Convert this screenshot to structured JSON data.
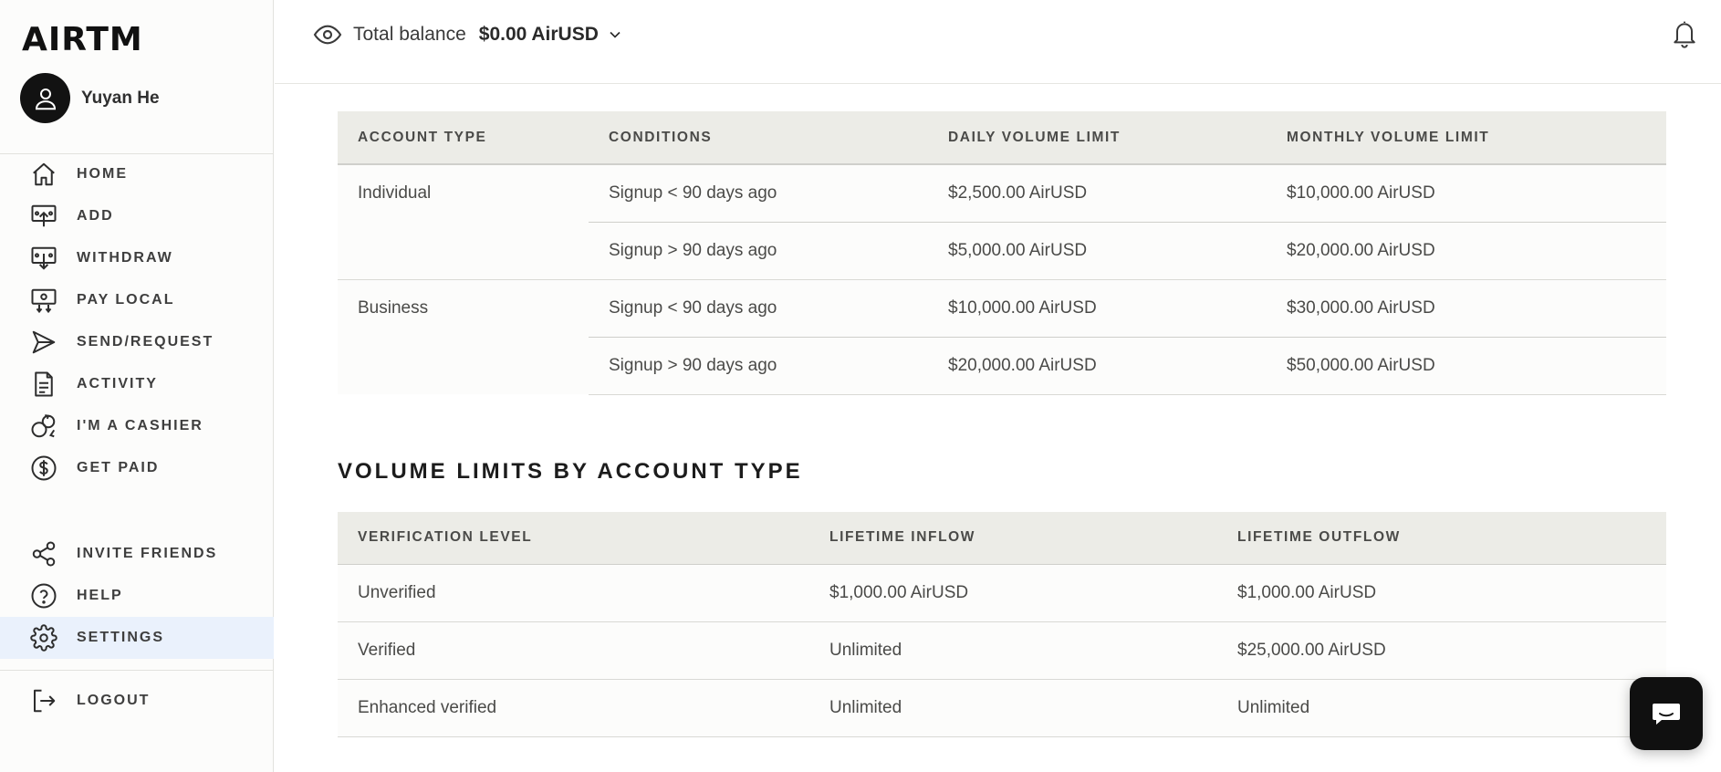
{
  "brand": {
    "logo_text": "AIRTM"
  },
  "user": {
    "name": "Yuyan He"
  },
  "nav": {
    "items": [
      {
        "label": "HOME",
        "icon": "home-icon"
      },
      {
        "label": "ADD",
        "icon": "add-funds-icon"
      },
      {
        "label": "WITHDRAW",
        "icon": "withdraw-icon"
      },
      {
        "label": "PAY LOCAL",
        "icon": "pay-local-icon"
      },
      {
        "label": "SEND/REQUEST",
        "icon": "send-icon"
      },
      {
        "label": "ACTIVITY",
        "icon": "document-icon"
      },
      {
        "label": "I'M A CASHIER",
        "icon": "cashier-icon"
      },
      {
        "label": "GET PAID",
        "icon": "dollar-icon"
      }
    ],
    "secondary": [
      {
        "label": "INVITE FRIENDS",
        "icon": "share-icon"
      },
      {
        "label": "HELP",
        "icon": "help-icon"
      },
      {
        "label": "SETTINGS",
        "icon": "gear-icon",
        "active": true
      }
    ],
    "logout": {
      "label": "LOGOUT",
      "icon": "logout-icon"
    }
  },
  "header": {
    "balance_label": "Total balance",
    "balance_value": "$0.00 AirUSD"
  },
  "limits_table": {
    "headers": [
      "ACCOUNT TYPE",
      "CONDITIONS",
      "DAILY VOLUME LIMIT",
      "MONTHLY VOLUME LIMIT"
    ],
    "groups": [
      {
        "type": "Individual",
        "rows": [
          {
            "condition": "Signup < 90 days ago",
            "daily": "$2,500.00 AirUSD",
            "monthly": "$10,000.00 AirUSD"
          },
          {
            "condition": "Signup > 90 days ago",
            "daily": "$5,000.00 AirUSD",
            "monthly": "$20,000.00 AirUSD"
          }
        ]
      },
      {
        "type": "Business",
        "rows": [
          {
            "condition": "Signup < 90 days ago",
            "daily": "$10,000.00 AirUSD",
            "monthly": "$30,000.00 AirUSD"
          },
          {
            "condition": "Signup > 90 days ago",
            "daily": "$20,000.00 AirUSD",
            "monthly": "$50,000.00 AirUSD"
          }
        ]
      }
    ]
  },
  "volume_section": {
    "title": "VOLUME LIMITS BY ACCOUNT TYPE",
    "headers": [
      "VERIFICATION LEVEL",
      "LIFETIME INFLOW",
      "LIFETIME OUTFLOW"
    ],
    "rows": [
      {
        "level": "Unverified",
        "inflow": "$1,000.00 AirUSD",
        "outflow": "$1,000.00 AirUSD"
      },
      {
        "level": "Verified",
        "inflow": "Unlimited",
        "outflow": "$25,000.00 AirUSD"
      },
      {
        "level": "Enhanced verified",
        "inflow": "Unlimited",
        "outflow": "Unlimited"
      }
    ]
  },
  "chat": {
    "icon": "chat-icon"
  }
}
